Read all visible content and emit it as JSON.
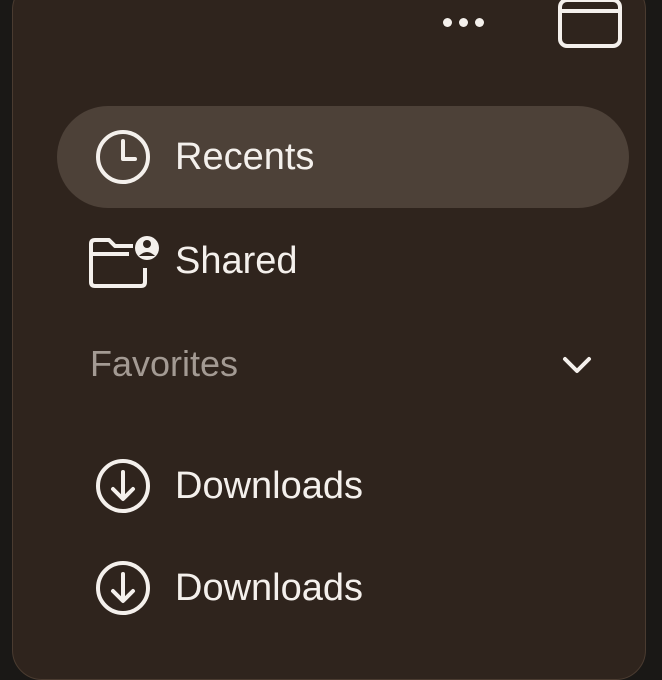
{
  "toolbar": {
    "more_icon": "ellipsis-icon",
    "sidebar_icon": "sidebar-toggle-icon"
  },
  "sidebar": {
    "items": [
      {
        "label": "Recents",
        "icon": "clock-icon",
        "selected": true
      },
      {
        "label": "Shared",
        "icon": "shared-folder-icon",
        "selected": false
      }
    ],
    "sections": [
      {
        "title": "Favorites",
        "expanded": true,
        "items": [
          {
            "label": "Downloads",
            "icon": "download-circle-icon"
          },
          {
            "label": "Downloads",
            "icon": "download-circle-icon"
          }
        ]
      }
    ]
  },
  "colors": {
    "panel_background": "#2f241d",
    "selected_background": "#4d4138",
    "text": "#f4f0ec",
    "section_text": "#a39a93"
  }
}
